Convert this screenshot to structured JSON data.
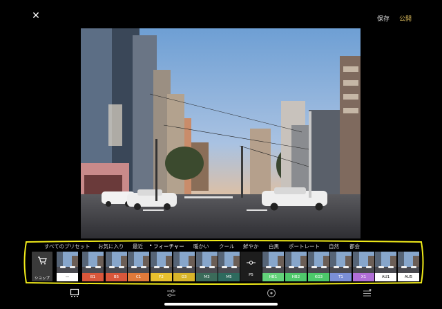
{
  "header": {
    "close_icon": "close-icon",
    "save_label": "保存",
    "publish_label": "公開",
    "publish_color": "#d8b85a"
  },
  "photo": {
    "description_icon": "photo-canvas"
  },
  "presets": {
    "categories": [
      "すべてのプリセット",
      "お気に入り",
      "最近",
      "フィーチャー",
      "暖かい",
      "クール",
      "鮮やか",
      "白黒",
      "ポートレート",
      "自然",
      "都会"
    ],
    "active_category": "フィーチャー",
    "shop_label": "ショップ",
    "tiles": [
      {
        "code": "—",
        "color": "#ffffff",
        "dark": true
      },
      {
        "code": "B1",
        "color": "#d9573b",
        "dark": false
      },
      {
        "code": "B5",
        "color": "#d9573b",
        "dark": false
      },
      {
        "code": "C1",
        "color": "#e07a3a",
        "dark": false
      },
      {
        "code": "F2",
        "color": "#e9c02e",
        "dark": false
      },
      {
        "code": "G3",
        "color": "#d8b52a",
        "dark": false
      },
      {
        "code": "M3",
        "color": "#3b6b5a",
        "dark": false
      },
      {
        "code": "M5",
        "color": "#2e6a5e",
        "dark": false
      },
      {
        "code": "P5",
        "color": "#1d1d1d",
        "dark": false
      },
      {
        "code": "HB1",
        "color": "#63d27a",
        "dark": false
      },
      {
        "code": "HB2",
        "color": "#4fc86b",
        "dark": false
      },
      {
        "code": "KG3",
        "color": "#4cc96a",
        "dark": false
      },
      {
        "code": "T1",
        "color": "#7b8fd6",
        "dark": false
      },
      {
        "code": "X1",
        "color": "#b06fd6",
        "dark": false
      },
      {
        "code": "AU1",
        "color": "#ffffff",
        "dark": true
      },
      {
        "code": "AU5",
        "color": "#ffffff",
        "dark": true
      }
    ],
    "annotation_color": "#f2ec1a"
  },
  "tabbar": {
    "tabs": [
      "photo-tab-icon",
      "adjust-tab-icon",
      "heal-tab-icon",
      "history-tab-icon"
    ]
  }
}
